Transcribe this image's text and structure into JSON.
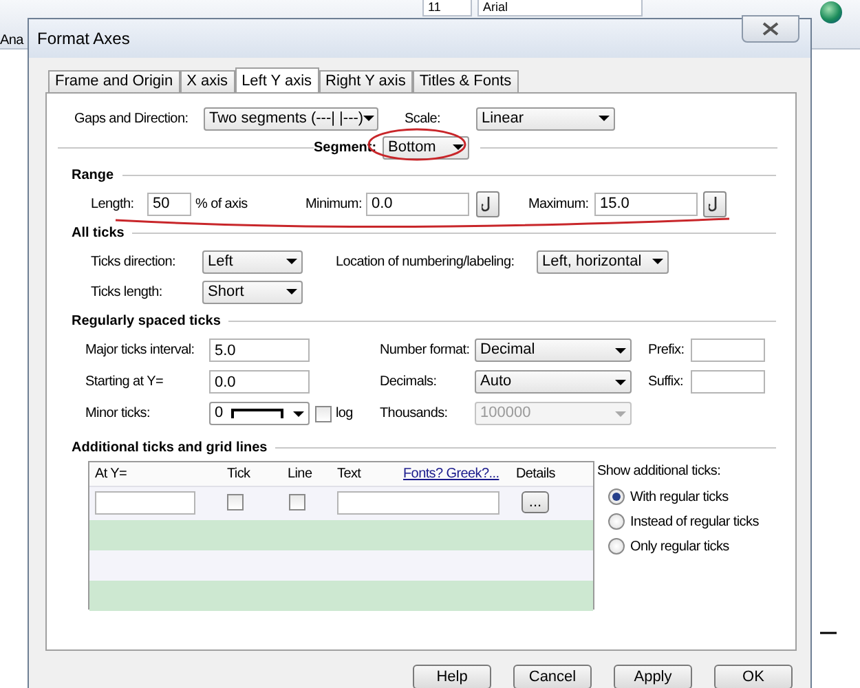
{
  "background_app": {
    "menu_label": "Ana",
    "font_size": "11",
    "font_name": "Arial"
  },
  "window": {
    "title": "Format Axes"
  },
  "tabs": [
    {
      "label": "Frame and Origin",
      "selected": false
    },
    {
      "label": "X axis",
      "selected": false
    },
    {
      "label": "Left Y axis",
      "selected": true
    },
    {
      "label": "Right Y axis",
      "selected": false
    },
    {
      "label": "Titles & Fonts",
      "selected": false
    }
  ],
  "header": {
    "gaps_label": "Gaps and Direction:",
    "gaps_value": "Two segments (---| |---)",
    "scale_label": "Scale:",
    "scale_value": "Linear",
    "segment_label": "Segment:",
    "segment_value": "Bottom"
  },
  "range": {
    "title": "Range",
    "length_label": "Length:",
    "length_value": "50",
    "length_unit": "% of axis",
    "minimum_label": "Minimum:",
    "minimum_value": "0.0",
    "maximum_label": "Maximum:",
    "maximum_value": "15.0"
  },
  "all_ticks": {
    "title": "All ticks",
    "direction_label": "Ticks direction:",
    "direction_value": "Left",
    "location_label": "Location of numbering/labeling:",
    "location_value": "Left, horizontal",
    "length_label": "Ticks length:",
    "length_value": "Short"
  },
  "regular_ticks": {
    "title": "Regularly spaced ticks",
    "major_label": "Major ticks interval:",
    "major_value": "5.0",
    "start_label": "Starting at Y=",
    "start_value": "0.0",
    "minor_label": "Minor ticks:",
    "minor_value": "0",
    "log": {
      "label": "log",
      "checked": false
    },
    "format_label": "Number format:",
    "format_value": "Decimal",
    "decimals_label": "Decimals:",
    "decimals_value": "Auto",
    "thousands_label": "Thousands:",
    "thousands_value": "100000",
    "thousands_disabled": true,
    "prefix_label": "Prefix:",
    "suffix_label": "Suffix:"
  },
  "additional": {
    "title": "Additional ticks and grid lines",
    "columns": [
      "At Y=",
      "Tick",
      "Line",
      "Text"
    ],
    "link": "Fonts? Greek?...",
    "details_label": "Details",
    "details_button": "...",
    "tick_checked": false,
    "line_checked": false,
    "show_label": "Show additional ticks:",
    "options": [
      {
        "label": "With regular ticks",
        "selected": true
      },
      {
        "label": "Instead of regular ticks",
        "selected": false
      },
      {
        "label": "Only regular ticks",
        "selected": false
      }
    ]
  },
  "buttons": [
    "Help",
    "Cancel",
    "Apply",
    "OK"
  ]
}
